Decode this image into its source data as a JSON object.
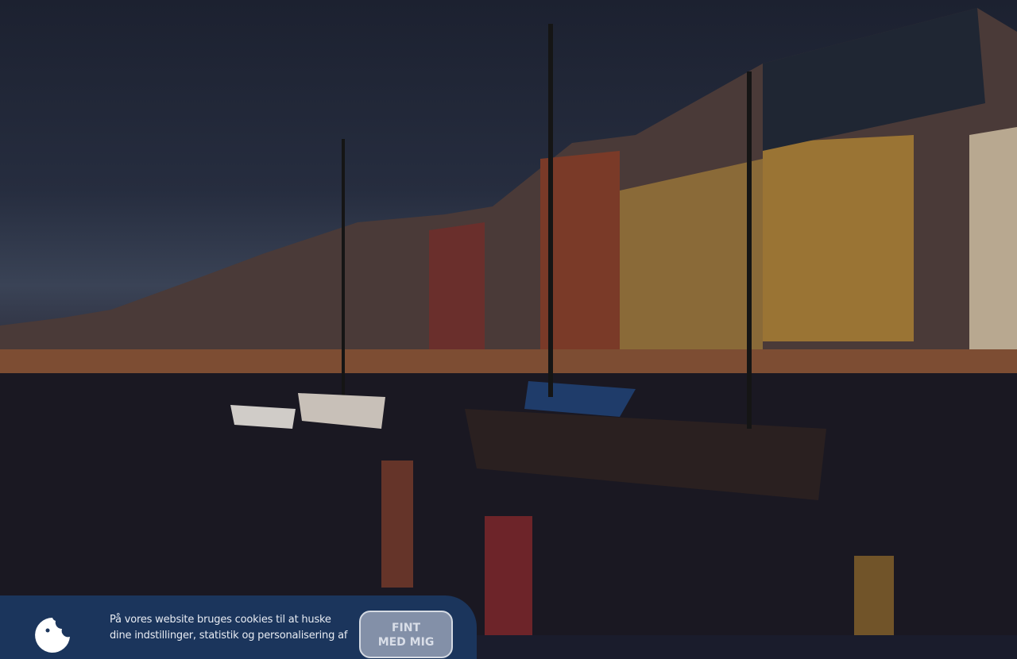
{
  "background": {
    "description_icon": "harbour-photo"
  },
  "cookie_banner": {
    "icon": "cookie-icon",
    "text": "På vores website bruges cookies til at huske dine indstillinger, statistik og personalisering af",
    "accept_button": {
      "line1": "FINT",
      "line2": "MED MIG"
    },
    "colors": {
      "background": "#1b355c",
      "button": "#8390a8"
    }
  }
}
